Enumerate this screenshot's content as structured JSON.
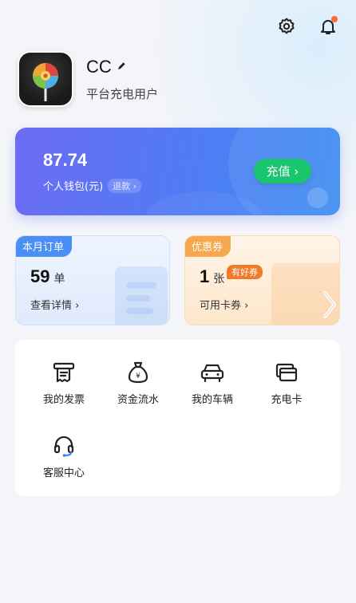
{
  "header": {
    "settings_icon": "gear-icon",
    "notification_icon": "bell-icon",
    "notification_dot_color": "#ff6a2a"
  },
  "profile": {
    "name": "CC",
    "user_type": "平台充电用户",
    "edit_icon": "pencil-icon"
  },
  "wallet": {
    "balance": "87.74",
    "label": "个人钱包(元)",
    "refund_label": "退款 ›",
    "recharge_label": "充值 ›",
    "recharge_color": "#19c66d"
  },
  "orders_card": {
    "tag": "本月订单",
    "count": "59",
    "unit": "单",
    "link": "查看详情 ›"
  },
  "coupons_card": {
    "tag": "优惠券",
    "count": "1",
    "unit": "张",
    "badge": "有好券",
    "link": "可用卡券 ›"
  },
  "tools": [
    {
      "label": "我的发票",
      "icon": "invoice-icon"
    },
    {
      "label": "资金流水",
      "icon": "money-bag-icon"
    },
    {
      "label": "我的车辆",
      "icon": "car-icon"
    },
    {
      "label": "充电卡",
      "icon": "card-icon"
    },
    {
      "label": "客服中心",
      "icon": "headset-icon"
    }
  ]
}
